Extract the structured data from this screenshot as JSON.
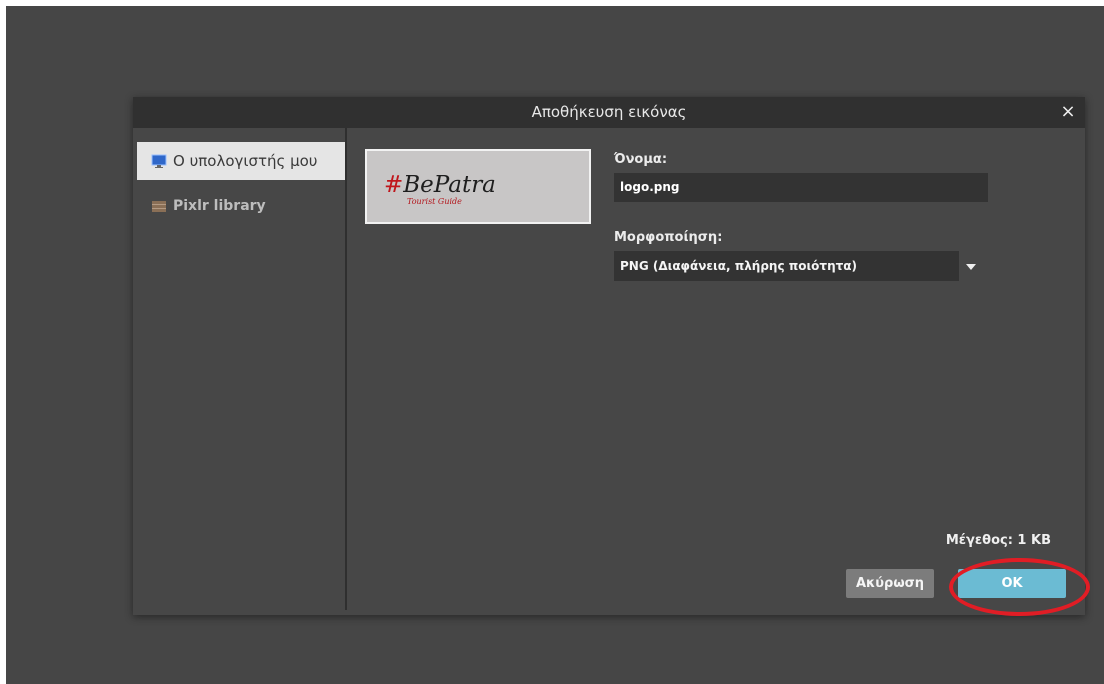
{
  "dialog": {
    "title": "Αποθήκευση εικόνας",
    "close_label": "×"
  },
  "sidebar": {
    "items": [
      {
        "label": "Ο υπολογιστής μου",
        "icon": "monitor-icon",
        "active": true
      },
      {
        "label": "Pixlr library",
        "icon": "library-icon",
        "active": false
      }
    ]
  },
  "preview": {
    "title_hash": "#",
    "title_text": "BePatra",
    "subtitle": "Tourist Guide"
  },
  "form": {
    "name_label": "Όνομα:",
    "name_value": "logo.png",
    "format_label": "Μορφοποίηση:",
    "format_value": "PNG (Διαφάνεια, πλήρης ποιότητα)"
  },
  "footer": {
    "size_text": "Μέγεθος: 1 KB",
    "cancel_label": "Ακύρωση",
    "ok_label": "OK"
  },
  "colors": {
    "ok_button": "#6bbbd3",
    "highlight": "#e11d25",
    "panel": "#474747",
    "titlebar": "#303030"
  }
}
